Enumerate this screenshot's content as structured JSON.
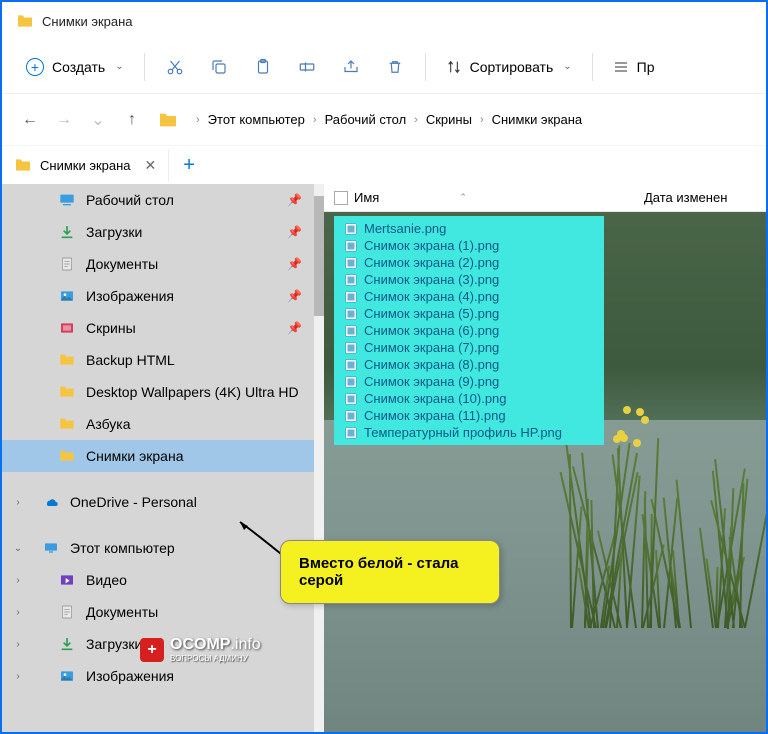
{
  "window": {
    "title": "Снимки экрана"
  },
  "toolbar": {
    "new_label": "Создать",
    "sort_label": "Сортировать",
    "view_label": "Пр"
  },
  "breadcrumbs": [
    "Этот компьютер",
    "Рабочий стол",
    "Скрины",
    "Снимки экрана"
  ],
  "tab": {
    "label": "Снимки экрана"
  },
  "columns": {
    "name": "Имя",
    "date": "Дата изменен"
  },
  "sidebar": {
    "items": [
      {
        "label": "Рабочий стол",
        "icon": "desktop",
        "pinned": true
      },
      {
        "label": "Загрузки",
        "icon": "download",
        "pinned": true
      },
      {
        "label": "Документы",
        "icon": "document",
        "pinned": true
      },
      {
        "label": "Изображения",
        "icon": "pictures",
        "pinned": true
      },
      {
        "label": "Скрины",
        "icon": "screenshot",
        "pinned": true
      },
      {
        "label": "Backup HTML",
        "icon": "folder",
        "pinned": false
      },
      {
        "label": "Desktop Wallpapers (4K) Ultra HD",
        "icon": "folder",
        "pinned": false
      },
      {
        "label": "Азбука",
        "icon": "folder",
        "pinned": false
      },
      {
        "label": "Снимки экрана",
        "icon": "folder",
        "pinned": false,
        "selected": true
      }
    ],
    "onedrive": "OneDrive - Personal",
    "thispc": "Этот компьютер",
    "pc_items": [
      {
        "label": "Видео",
        "icon": "video"
      },
      {
        "label": "Документы",
        "icon": "document"
      },
      {
        "label": "Загрузки",
        "icon": "download"
      },
      {
        "label": "Изображения",
        "icon": "pictures"
      }
    ]
  },
  "files": [
    "Mertsanie.png",
    "Снимок экрана (1).png",
    "Снимок экрана (2).png",
    "Снимок экрана (3).png",
    "Снимок экрана (4).png",
    "Снимок экрана (5).png",
    "Снимок экрана (6).png",
    "Снимок экрана (7).png",
    "Снимок экрана (8).png",
    "Снимок экрана (9).png",
    "Снимок экрана (10).png",
    "Снимок экрана (11).png",
    "Температурный профиль HP.png"
  ],
  "callout": {
    "text": "Вместо белой - стала серой"
  },
  "watermark": {
    "brand": "OCOMP",
    "suffix": ".info",
    "sub": "ВОПРОСЫ АДМИНУ"
  }
}
